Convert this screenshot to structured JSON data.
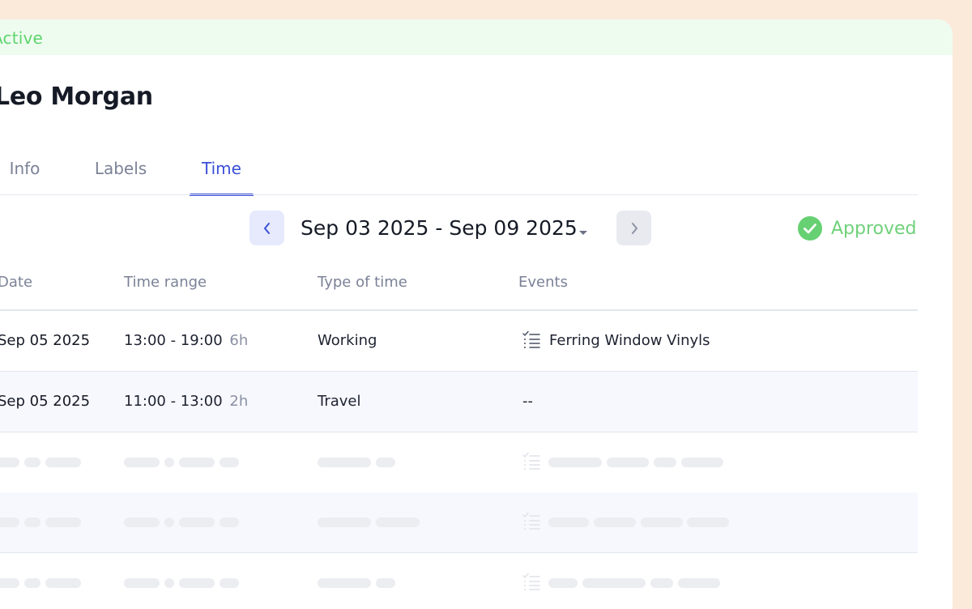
{
  "status": {
    "label": "Active",
    "color": "#5fd46c"
  },
  "page": {
    "title": "Leo Morgan"
  },
  "tabs": [
    {
      "label": "Info",
      "active": false
    },
    {
      "label": "Labels",
      "active": false
    },
    {
      "label": "Time",
      "active": true
    }
  ],
  "week": {
    "range": "Sep 03 2025 - Sep 09 2025",
    "prev_icon": "chevron-left-icon",
    "next_icon": "chevron-right-icon",
    "dropdown_icon": "caret-down-icon"
  },
  "approval": {
    "label": "Approved",
    "icon": "check-circle-icon",
    "color": "#5fd46c"
  },
  "table": {
    "columns": [
      "Date",
      "Time range",
      "Type of time",
      "Events"
    ],
    "rows": [
      {
        "date": "Sep 05 2025",
        "range": "13:00 - 19:00",
        "duration": "6h",
        "type": "Working",
        "event": "Ferring Window Vinyls",
        "event_icon": "checklist-icon"
      },
      {
        "date": "Sep 05 2025",
        "range": "11:00 - 13:00",
        "duration": "2h",
        "type": "Travel",
        "event": "--"
      }
    ],
    "placeholder_rows": 3
  },
  "colors": {
    "accent": "#3a4fd8",
    "background": "#fbe9da",
    "approved": "#6fd17a"
  }
}
